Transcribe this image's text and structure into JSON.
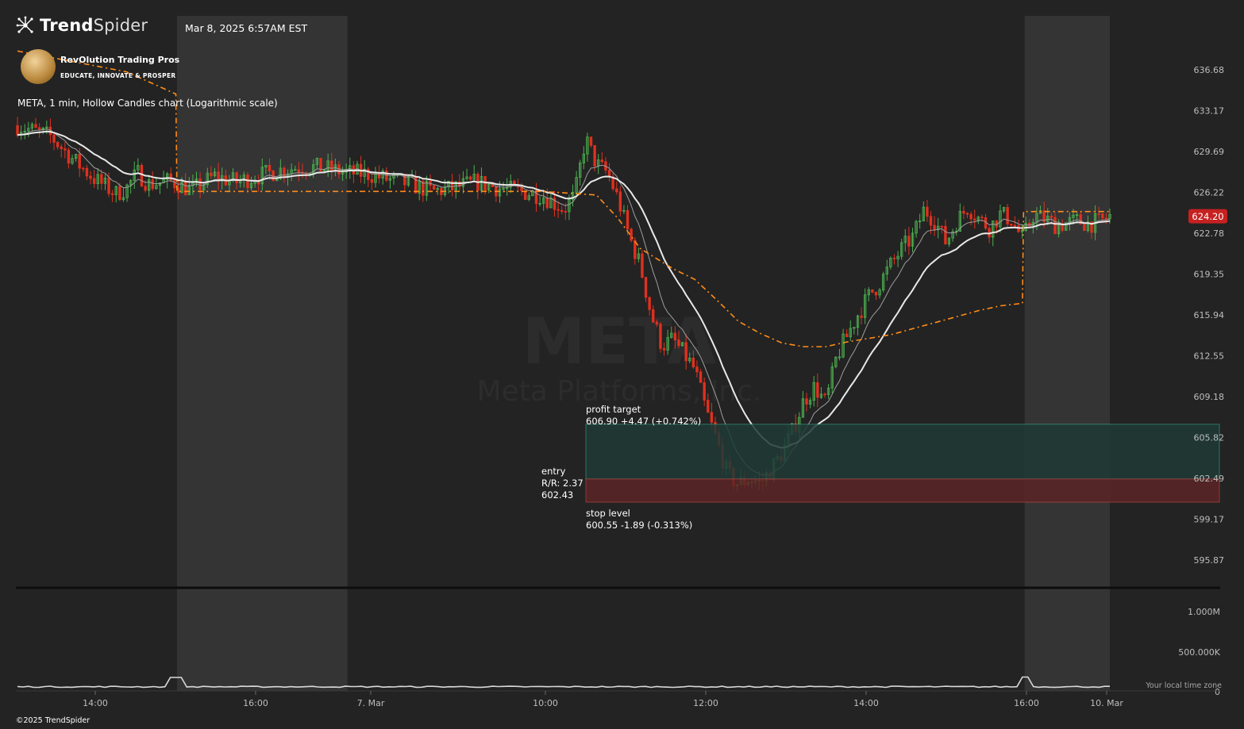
{
  "header": {
    "brand_strong": "Trend",
    "brand_light": "Spider",
    "brand_icon": "spider-network-icon",
    "timestamp": "Mar 8, 2025 6:57AM EST",
    "partner_name": "RevOlution Trading Pros",
    "partner_tagline": "EDUCATE, INNOVATE & PROSPER"
  },
  "chart_description": "META, 1 min, Hollow Candles chart (Logarithmic scale)",
  "watermark": {
    "ticker": "META",
    "company": "Meta Platforms, Inc."
  },
  "footer": {
    "copyright": "©2025 TrendSpider",
    "timezone_note": "Your local time zone"
  },
  "colors": {
    "background": "#232323",
    "session_shade": "#343434",
    "up_candle": "#4caf50",
    "down_candle": "#e0301e",
    "vwap": "#ff8c1a",
    "ma_fast": "#9e9e9e",
    "ma_slow": "#e8e8e8",
    "profit_zone": "#1e3a36",
    "stop_zone": "#5a2426",
    "last_price_badge": "#c62121"
  },
  "chart_data": {
    "type": "candlestick",
    "symbol": "META",
    "interval": "1 min",
    "scale": "log",
    "price_axis": {
      "ticks": [
        636.68,
        633.17,
        629.69,
        626.22,
        622.78,
        619.35,
        615.94,
        612.55,
        609.18,
        605.82,
        602.49,
        599.17,
        595.87
      ],
      "range": [
        593.5,
        639.5
      ]
    },
    "volume_axis": {
      "ticks": [
        "1.000M",
        "500.000K",
        "0"
      ]
    },
    "time_axis": {
      "labels": [
        "14:00",
        "16:00",
        "7. Mar",
        "10:00",
        "12:00",
        "14:00",
        "16:00",
        "10. Mar"
      ]
    },
    "last_price": 624.2,
    "price_path": [
      [
        0,
        631.9
      ],
      [
        3,
        631.0
      ],
      [
        5,
        629.1
      ],
      [
        7,
        627.4
      ],
      [
        9,
        626.1
      ],
      [
        10,
        626.6
      ],
      [
        11,
        627.9
      ],
      [
        12,
        626.9
      ],
      [
        14,
        627.2
      ],
      [
        16,
        626.4
      ],
      [
        18,
        627.6
      ],
      [
        20,
        627.1
      ],
      [
        22,
        627.6
      ],
      [
        24,
        628.1
      ],
      [
        26,
        628.4
      ],
      [
        28,
        628.3
      ],
      [
        30,
        627.9
      ],
      [
        32,
        627.8
      ],
      [
        34,
        627.3
      ],
      [
        36,
        626.9
      ],
      [
        38,
        626.3
      ],
      [
        40,
        626.6
      ],
      [
        42,
        627.1
      ],
      [
        44,
        626.6
      ],
      [
        46,
        626.3
      ],
      [
        48,
        626.0
      ],
      [
        50,
        624.8
      ],
      [
        51,
        625.9
      ],
      [
        52,
        630.8
      ],
      [
        53,
        628.6
      ],
      [
        54,
        627.9
      ],
      [
        55,
        625.6
      ],
      [
        56,
        622.5
      ],
      [
        57,
        620.1
      ],
      [
        58,
        616.0
      ],
      [
        59,
        613.4
      ],
      [
        60,
        613.9
      ],
      [
        61,
        612.7
      ],
      [
        62,
        611.4
      ],
      [
        63,
        608.1
      ],
      [
        64,
        605.6
      ],
      [
        65,
        602.8
      ],
      [
        66,
        602.0
      ],
      [
        67,
        602.5
      ],
      [
        68,
        602.1
      ],
      [
        69,
        603.2
      ],
      [
        70,
        604.6
      ],
      [
        71,
        606.4
      ],
      [
        72,
        608.9
      ],
      [
        73,
        610.0
      ],
      [
        74,
        608.6
      ],
      [
        75,
        612.5
      ],
      [
        76,
        614.3
      ],
      [
        77,
        616.1
      ],
      [
        78,
        617.6
      ],
      [
        79,
        618.7
      ],
      [
        80,
        620.2
      ],
      [
        81,
        621.5
      ],
      [
        82,
        622.5
      ],
      [
        83,
        624.8
      ],
      [
        84,
        623.8
      ],
      [
        85,
        622.0
      ],
      [
        86,
        623.8
      ],
      [
        87,
        625.0
      ],
      [
        88,
        624.0
      ],
      [
        89,
        623.2
      ],
      [
        90,
        624.4
      ],
      [
        91,
        623.9
      ],
      [
        92,
        622.3
      ],
      [
        93,
        624.3
      ],
      [
        94,
        624.0
      ],
      [
        95,
        623.5
      ],
      [
        96,
        623.6
      ],
      [
        97,
        623.8
      ],
      [
        98,
        623.6
      ],
      [
        99,
        623.7
      ],
      [
        100,
        624.2
      ]
    ],
    "moving_averages": [
      {
        "role": "fast",
        "color": "#9e9e9e"
      },
      {
        "role": "slow",
        "color": "#e8e8e8"
      }
    ],
    "vwap": [
      [
        0,
        638.3
      ],
      [
        10,
        636.5
      ],
      [
        14.5,
        634.6
      ],
      [
        14.6,
        626.3
      ],
      [
        30,
        626.3
      ],
      [
        48,
        626.3
      ],
      [
        53,
        626.0
      ],
      [
        55,
        624.0
      ],
      [
        57,
        621.5
      ],
      [
        60,
        619.8
      ],
      [
        62,
        618.9
      ],
      [
        64,
        617.2
      ],
      [
        66,
        615.4
      ],
      [
        68,
        614.4
      ],
      [
        70,
        613.6
      ],
      [
        72,
        613.3
      ],
      [
        74,
        613.3
      ],
      [
        76,
        613.7
      ],
      [
        78,
        614.0
      ],
      [
        80,
        614.3
      ],
      [
        82,
        614.8
      ],
      [
        84,
        615.3
      ],
      [
        86,
        615.8
      ],
      [
        88,
        616.3
      ],
      [
        89,
        616.5
      ],
      [
        90,
        616.7
      ],
      [
        92,
        616.9
      ],
      [
        92.1,
        624.6
      ],
      [
        100,
        624.6
      ]
    ],
    "sessions": [
      {
        "label": "extended",
        "from": 14.6,
        "to": 30.2
      },
      {
        "label": "extended",
        "from": 92.2,
        "to": 100
      }
    ],
    "trade_setup": {
      "entry_label": "entry",
      "rr_label": "R/R: 2.37",
      "entry_price": "602.43",
      "profit_label": "profit target",
      "profit_text": "606.90 +4.47 (+0.742%)",
      "stop_label": "stop level",
      "stop_text": "600.55 -1.89 (-0.313%)",
      "entry": 602.43,
      "target": 606.9,
      "stop": 600.55
    },
    "volume_spikes": [
      {
        "at": 14.6,
        "value": 0.28
      },
      {
        "at": 92.2,
        "value": 0.29
      }
    ]
  }
}
